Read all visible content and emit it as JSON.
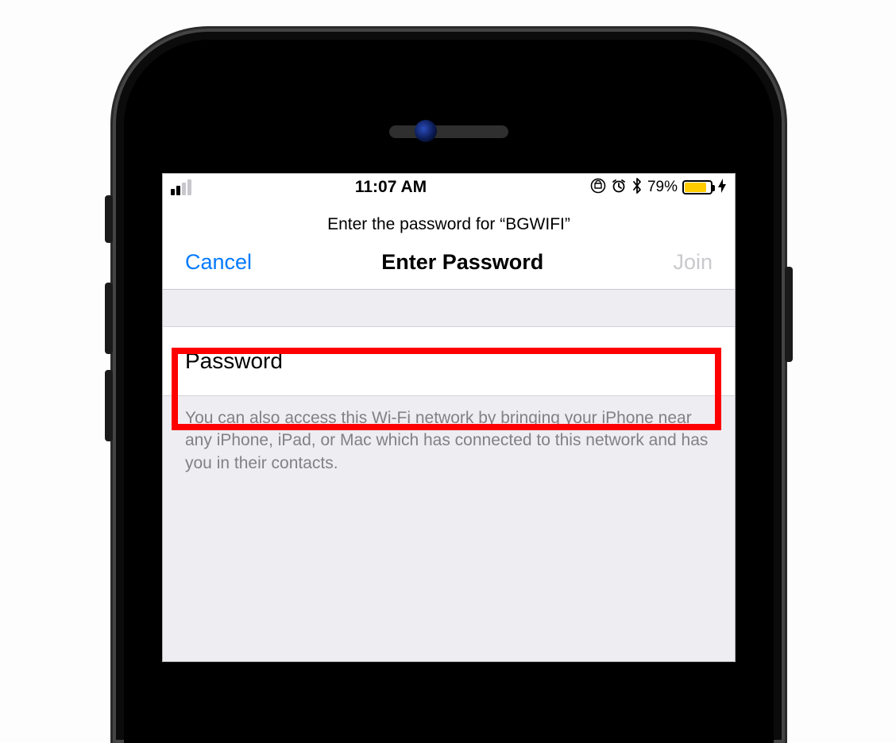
{
  "statusbar": {
    "time": "11:07 AM",
    "battery_percent": "79%",
    "icons": {
      "signal": "signal-2-of-4",
      "orientation_lock": "orientation-lock",
      "alarm": "alarm",
      "bluetooth": "bluetooth",
      "charging": "charging-bolt"
    }
  },
  "header": {
    "prompt": "Enter the password for “BGWIFI”",
    "cancel": "Cancel",
    "title": "Enter Password",
    "join": "Join",
    "join_enabled": false
  },
  "form": {
    "password_label": "Password",
    "password_value": ""
  },
  "help": "You can also access this Wi-Fi network by bringing your iPhone near any iPhone, iPad, or Mac which has connected to this network and has you in their contacts.",
  "annotation": {
    "highlight_color": "#ff0000"
  }
}
